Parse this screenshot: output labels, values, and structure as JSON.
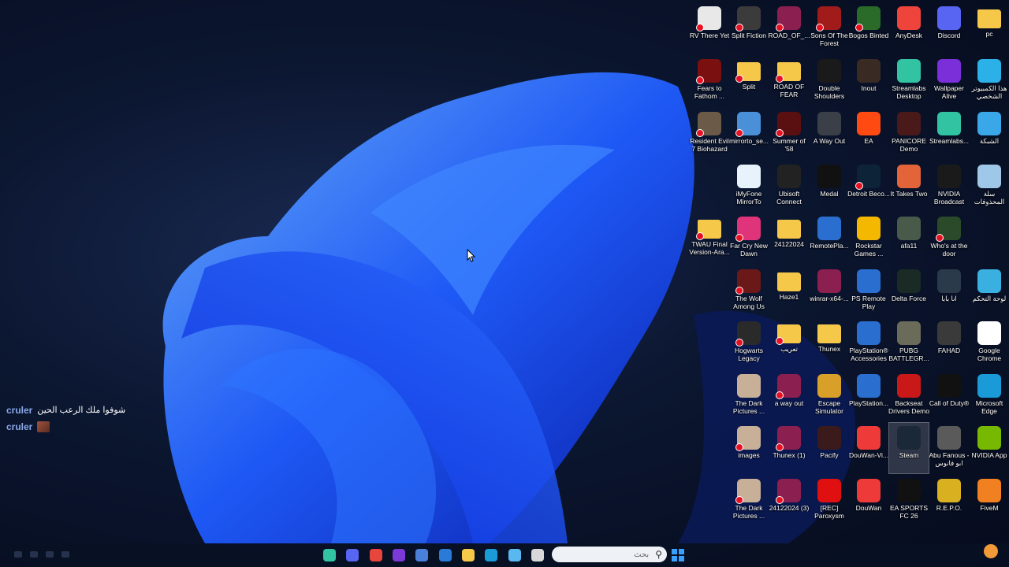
{
  "colors": {
    "accent": "#1f62ff",
    "taskbar": "#0a1428"
  },
  "desktop_icons": [
    {
      "label": "RV There Yet",
      "icon": "document-icon",
      "color": "#e8e8e8",
      "err": true
    },
    {
      "label": "Split Fiction",
      "icon": "sf-icon",
      "color": "#3b3b3b",
      "err": true
    },
    {
      "label": "ROAD_OF_...",
      "icon": "winrar-icon",
      "color": "#8b1f4f",
      "err": true
    },
    {
      "label": "Sons Of The Forest",
      "icon": "game-icon",
      "color": "#a11b1b",
      "err": true
    },
    {
      "label": "Bogos Binted",
      "icon": "alien-icon",
      "color": "#2a6b2a",
      "err": true
    },
    {
      "label": "AnyDesk",
      "icon": "anydesk-icon",
      "color": "#ef443b",
      "err": false
    },
    {
      "label": "Discord",
      "icon": "discord-icon",
      "color": "#5865f2",
      "err": false
    },
    {
      "label": "pc",
      "icon": "folder-icon",
      "color": "#f5c84a",
      "err": false
    },
    {
      "label": "Fears to Fathom ...",
      "icon": "f2f-icon",
      "color": "#7a1010",
      "err": true
    },
    {
      "label": "Split",
      "icon": "folder-icon",
      "color": "#f5c84a",
      "err": true
    },
    {
      "label": "ROAD OF FEAR ARABIC",
      "icon": "folder-icon",
      "color": "#f5c84a",
      "err": true
    },
    {
      "label": "Double Shoulders",
      "icon": "ds-icon",
      "color": "#1a1a1a",
      "err": false
    },
    {
      "label": "Inout",
      "icon": "game-icon",
      "color": "#3a2a24",
      "err": false
    },
    {
      "label": "Streamlabs Desktop",
      "icon": "streamlabs-icon",
      "color": "#31c3a2",
      "err": false
    },
    {
      "label": "Wallpaper Alive",
      "icon": "wa-icon",
      "color": "#7b2fd8",
      "err": false
    },
    {
      "label": "هذا الكمبيوتر الشخصي",
      "icon": "monitor-icon",
      "color": "#2bb0e8",
      "err": false
    },
    {
      "label": "Resident Evil 7 Biohazard",
      "icon": "game-icon",
      "color": "#6b5a48",
      "err": true
    },
    {
      "label": "mirrorto_se...",
      "icon": "installer-icon",
      "color": "#4a90d9",
      "err": true
    },
    {
      "label": "Summer of '58",
      "icon": "game-icon",
      "color": "#5a1010",
      "err": true
    },
    {
      "label": "A Way Out",
      "icon": "game-icon",
      "color": "#3a3f48",
      "err": false
    },
    {
      "label": "EA",
      "icon": "ea-icon",
      "color": "#ff4a12",
      "err": false
    },
    {
      "label": "PANICORE Demo",
      "icon": "game-icon",
      "color": "#4a1a1a",
      "err": false
    },
    {
      "label": "Streamlabs...",
      "icon": "streamlabs-icon",
      "color": "#31c3a2",
      "err": false
    },
    {
      "label": "الشبكة",
      "icon": "network-icon",
      "color": "#3aa8e8",
      "err": false
    },
    {
      "label": "iMyFone MirrorTo",
      "icon": "mirrorto-icon",
      "color": "#e8f2fb",
      "err": false
    },
    {
      "label": "Ubisoft Connect",
      "icon": "ubisoft-icon",
      "color": "#222",
      "err": false
    },
    {
      "label": "Medal",
      "icon": "medal-icon",
      "color": "#111",
      "err": false
    },
    {
      "label": "Detroit Beco...",
      "icon": "ring-icon",
      "color": "#0d2438",
      "err": true
    },
    {
      "label": "It Takes Two",
      "icon": "game-icon",
      "color": "#e4643a",
      "err": false
    },
    {
      "label": "NVIDIA Broadcast",
      "icon": "nvidia-icon",
      "color": "#1a1a1a",
      "err": false
    },
    {
      "label": "سلة المحذوفات",
      "icon": "recycle-bin-icon",
      "color": "#9fc8e8",
      "err": false
    },
    {
      "label": "TWAU Final Version-Ara...",
      "icon": "folder-icon",
      "color": "#f5c84a",
      "err": true
    },
    {
      "label": "Far Cry New Dawn",
      "icon": "game-icon",
      "color": "#e0347a",
      "err": true
    },
    {
      "label": "24122024",
      "icon": "folder-icon",
      "color": "#f5c84a",
      "err": false
    },
    {
      "label": "RemotePla...",
      "icon": "ps-icon",
      "color": "#2a6fd0",
      "err": false
    },
    {
      "label": "Rockstar Games ...",
      "icon": "rockstar-icon",
      "color": "#f5b800",
      "err": false
    },
    {
      "label": "afa11",
      "icon": "image-icon",
      "color": "#4a5a4a",
      "err": false
    },
    {
      "label": "Who's at the door",
      "icon": "game-icon",
      "color": "#2a4a2a",
      "err": true
    },
    {
      "label": "The Wolf Among Us",
      "icon": "game-icon",
      "color": "#6a1818",
      "err": true
    },
    {
      "label": "Haze1",
      "icon": "folder-icon",
      "color": "#f5c84a",
      "err": false
    },
    {
      "label": "winrar-x64-...",
      "icon": "winrar-icon",
      "color": "#8b1f4f",
      "err": false
    },
    {
      "label": "PS Remote Play",
      "icon": "ps-icon",
      "color": "#2a6fd0",
      "err": false
    },
    {
      "label": "Delta Force",
      "icon": "delta-icon",
      "color": "#1a2a24",
      "err": false
    },
    {
      "label": "انا بابا",
      "icon": "image-icon",
      "color": "#2a3a4a",
      "err": false
    },
    {
      "label": "لوحة التحكم",
      "icon": "control-panel-icon",
      "color": "#3ab0e0",
      "err": false
    },
    {
      "label": "Hogwarts Legacy",
      "icon": "game-icon",
      "color": "#2a2a2a",
      "err": true
    },
    {
      "label": "تعريب",
      "icon": "folder-icon",
      "color": "#f5c84a",
      "err": true
    },
    {
      "label": "Thunex",
      "icon": "folder-icon",
      "color": "#f5c84a",
      "err": false
    },
    {
      "label": "PlayStation® Accessories",
      "icon": "ps-icon",
      "color": "#2a6fd0",
      "err": false
    },
    {
      "label": "PUBG BATTLEGR...",
      "icon": "pubg-icon",
      "color": "#6b6b5a",
      "err": false
    },
    {
      "label": "FAHAD",
      "icon": "image-icon",
      "color": "#3a3a3a",
      "err": false
    },
    {
      "label": "Google Chrome",
      "icon": "chrome-icon",
      "color": "#ffffff",
      "err": false
    },
    {
      "label": "The Dark Pictures ...",
      "icon": "game-icon",
      "color": "#c8b098",
      "err": false
    },
    {
      "label": "a way out",
      "icon": "winrar-icon",
      "color": "#8b1f4f",
      "err": true
    },
    {
      "label": "Escape Simulator",
      "icon": "keyhole-icon",
      "color": "#d8a028",
      "err": false
    },
    {
      "label": "PlayStation...",
      "icon": "ps-icon",
      "color": "#2a6fd0",
      "err": false
    },
    {
      "label": "Backseat Drivers Demo",
      "icon": "car-icon",
      "color": "#c81818",
      "err": false
    },
    {
      "label": "Call of Duty®",
      "icon": "cod-icon",
      "color": "#111",
      "err": false
    },
    {
      "label": "Microsoft Edge",
      "icon": "edge-icon",
      "color": "#1a9bd8",
      "err": false
    },
    {
      "label": "images",
      "icon": "image-icon",
      "color": "#c8b098",
      "err": true
    },
    {
      "label": "Thunex (1)",
      "icon": "winrar-icon",
      "color": "#8b1f4f",
      "err": true
    },
    {
      "label": "Pacify",
      "icon": "game-icon",
      "color": "#3a1a1a",
      "err": false
    },
    {
      "label": "DouWan-Vi...",
      "icon": "douwan-icon",
      "color": "#ef3a3a",
      "err": false
    },
    {
      "label": "Steam",
      "icon": "steam-icon",
      "color": "#1b2838",
      "err": false,
      "selected": true
    },
    {
      "label": "Abu Fanous - ابو فانوس",
      "icon": "game-icon",
      "color": "#5a5a5a",
      "err": false
    },
    {
      "label": "NVIDIA App",
      "icon": "nvidia-icon",
      "color": "#76b900",
      "err": false
    },
    {
      "label": "The Dark Pictures ...",
      "icon": "game-icon",
      "color": "#c8b098",
      "err": true
    },
    {
      "label": "24122024 (3)",
      "icon": "winrar-icon",
      "color": "#8b1f4f",
      "err": true
    },
    {
      "label": "[REC] Paroxysm",
      "icon": "rec-icon",
      "color": "#e01010",
      "err": false
    },
    {
      "label": "DouWan",
      "icon": "douwan-icon",
      "color": "#ef3a3a",
      "err": false
    },
    {
      "label": "EA SPORTS FC 26",
      "icon": "fc-icon",
      "color": "#111",
      "err": false
    },
    {
      "label": "R.E.P.O.",
      "icon": "repo-icon",
      "color": "#d8b020",
      "err": false
    },
    {
      "label": "FiveM",
      "icon": "fivem-icon",
      "color": "#f08020",
      "err": false
    }
  ],
  "chat": [
    {
      "user": "cruler",
      "message": "شوفوا ملك الرعب الحين"
    },
    {
      "user": "cruler",
      "message": ""
    }
  ],
  "taskbar": {
    "search_placeholder": "بحث",
    "apps": [
      {
        "name": "streamlabs-icon",
        "color": "#31c3a2"
      },
      {
        "name": "discord-icon",
        "color": "#5865f2"
      },
      {
        "name": "chrome-icon",
        "color": "#e8453c"
      },
      {
        "name": "app-icon",
        "color": "#7b3ad8"
      },
      {
        "name": "ai-icon",
        "color": "#4a80d8"
      },
      {
        "name": "store-icon",
        "color": "#2a7ad8"
      },
      {
        "name": "explorer-icon",
        "color": "#f5c84a"
      },
      {
        "name": "edge-icon",
        "color": "#1a9bd8"
      },
      {
        "name": "copilot-icon",
        "color": "#5ab8f0"
      },
      {
        "name": "notepad-icon",
        "color": "#d8d8d8"
      }
    ]
  }
}
